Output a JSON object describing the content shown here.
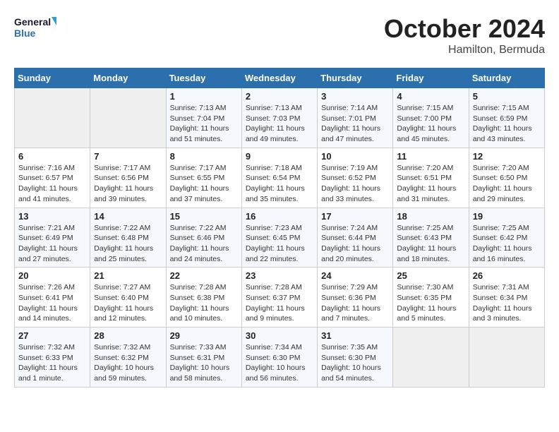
{
  "header": {
    "logo_line1": "General",
    "logo_line2": "Blue",
    "month": "October 2024",
    "location": "Hamilton, Bermuda"
  },
  "columns": [
    "Sunday",
    "Monday",
    "Tuesday",
    "Wednesday",
    "Thursday",
    "Friday",
    "Saturday"
  ],
  "weeks": [
    [
      {
        "day": "",
        "info": ""
      },
      {
        "day": "",
        "info": ""
      },
      {
        "day": "1",
        "info": "Sunrise: 7:13 AM\nSunset: 7:04 PM\nDaylight: 11 hours and 51 minutes."
      },
      {
        "day": "2",
        "info": "Sunrise: 7:13 AM\nSunset: 7:03 PM\nDaylight: 11 hours and 49 minutes."
      },
      {
        "day": "3",
        "info": "Sunrise: 7:14 AM\nSunset: 7:01 PM\nDaylight: 11 hours and 47 minutes."
      },
      {
        "day": "4",
        "info": "Sunrise: 7:15 AM\nSunset: 7:00 PM\nDaylight: 11 hours and 45 minutes."
      },
      {
        "day": "5",
        "info": "Sunrise: 7:15 AM\nSunset: 6:59 PM\nDaylight: 11 hours and 43 minutes."
      }
    ],
    [
      {
        "day": "6",
        "info": "Sunrise: 7:16 AM\nSunset: 6:57 PM\nDaylight: 11 hours and 41 minutes."
      },
      {
        "day": "7",
        "info": "Sunrise: 7:17 AM\nSunset: 6:56 PM\nDaylight: 11 hours and 39 minutes."
      },
      {
        "day": "8",
        "info": "Sunrise: 7:17 AM\nSunset: 6:55 PM\nDaylight: 11 hours and 37 minutes."
      },
      {
        "day": "9",
        "info": "Sunrise: 7:18 AM\nSunset: 6:54 PM\nDaylight: 11 hours and 35 minutes."
      },
      {
        "day": "10",
        "info": "Sunrise: 7:19 AM\nSunset: 6:52 PM\nDaylight: 11 hours and 33 minutes."
      },
      {
        "day": "11",
        "info": "Sunrise: 7:20 AM\nSunset: 6:51 PM\nDaylight: 11 hours and 31 minutes."
      },
      {
        "day": "12",
        "info": "Sunrise: 7:20 AM\nSunset: 6:50 PM\nDaylight: 11 hours and 29 minutes."
      }
    ],
    [
      {
        "day": "13",
        "info": "Sunrise: 7:21 AM\nSunset: 6:49 PM\nDaylight: 11 hours and 27 minutes."
      },
      {
        "day": "14",
        "info": "Sunrise: 7:22 AM\nSunset: 6:48 PM\nDaylight: 11 hours and 25 minutes."
      },
      {
        "day": "15",
        "info": "Sunrise: 7:22 AM\nSunset: 6:46 PM\nDaylight: 11 hours and 24 minutes."
      },
      {
        "day": "16",
        "info": "Sunrise: 7:23 AM\nSunset: 6:45 PM\nDaylight: 11 hours and 22 minutes."
      },
      {
        "day": "17",
        "info": "Sunrise: 7:24 AM\nSunset: 6:44 PM\nDaylight: 11 hours and 20 minutes."
      },
      {
        "day": "18",
        "info": "Sunrise: 7:25 AM\nSunset: 6:43 PM\nDaylight: 11 hours and 18 minutes."
      },
      {
        "day": "19",
        "info": "Sunrise: 7:25 AM\nSunset: 6:42 PM\nDaylight: 11 hours and 16 minutes."
      }
    ],
    [
      {
        "day": "20",
        "info": "Sunrise: 7:26 AM\nSunset: 6:41 PM\nDaylight: 11 hours and 14 minutes."
      },
      {
        "day": "21",
        "info": "Sunrise: 7:27 AM\nSunset: 6:40 PM\nDaylight: 11 hours and 12 minutes."
      },
      {
        "day": "22",
        "info": "Sunrise: 7:28 AM\nSunset: 6:38 PM\nDaylight: 11 hours and 10 minutes."
      },
      {
        "day": "23",
        "info": "Sunrise: 7:28 AM\nSunset: 6:37 PM\nDaylight: 11 hours and 9 minutes."
      },
      {
        "day": "24",
        "info": "Sunrise: 7:29 AM\nSunset: 6:36 PM\nDaylight: 11 hours and 7 minutes."
      },
      {
        "day": "25",
        "info": "Sunrise: 7:30 AM\nSunset: 6:35 PM\nDaylight: 11 hours and 5 minutes."
      },
      {
        "day": "26",
        "info": "Sunrise: 7:31 AM\nSunset: 6:34 PM\nDaylight: 11 hours and 3 minutes."
      }
    ],
    [
      {
        "day": "27",
        "info": "Sunrise: 7:32 AM\nSunset: 6:33 PM\nDaylight: 11 hours and 1 minute."
      },
      {
        "day": "28",
        "info": "Sunrise: 7:32 AM\nSunset: 6:32 PM\nDaylight: 10 hours and 59 minutes."
      },
      {
        "day": "29",
        "info": "Sunrise: 7:33 AM\nSunset: 6:31 PM\nDaylight: 10 hours and 58 minutes."
      },
      {
        "day": "30",
        "info": "Sunrise: 7:34 AM\nSunset: 6:30 PM\nDaylight: 10 hours and 56 minutes."
      },
      {
        "day": "31",
        "info": "Sunrise: 7:35 AM\nSunset: 6:30 PM\nDaylight: 10 hours and 54 minutes."
      },
      {
        "day": "",
        "info": ""
      },
      {
        "day": "",
        "info": ""
      }
    ]
  ]
}
